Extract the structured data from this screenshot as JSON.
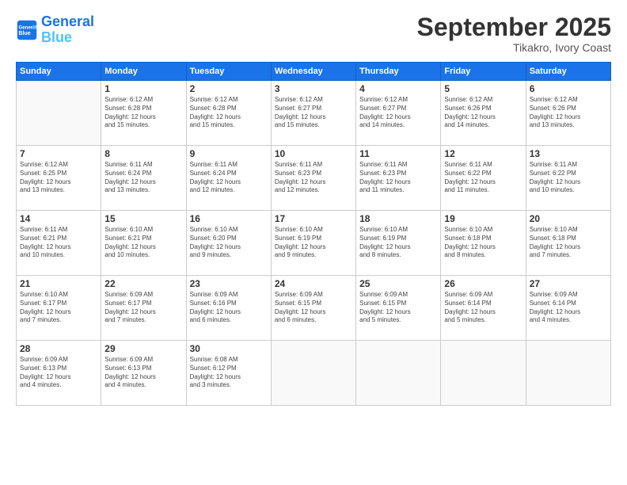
{
  "header": {
    "logo_line1": "General",
    "logo_line2": "Blue",
    "month": "September 2025",
    "location": "Tikakro, Ivory Coast"
  },
  "weekdays": [
    "Sunday",
    "Monday",
    "Tuesday",
    "Wednesday",
    "Thursday",
    "Friday",
    "Saturday"
  ],
  "weeks": [
    [
      {
        "day": "",
        "info": ""
      },
      {
        "day": "1",
        "info": "Sunrise: 6:12 AM\nSunset: 6:28 PM\nDaylight: 12 hours\nand 15 minutes."
      },
      {
        "day": "2",
        "info": "Sunrise: 6:12 AM\nSunset: 6:28 PM\nDaylight: 12 hours\nand 15 minutes."
      },
      {
        "day": "3",
        "info": "Sunrise: 6:12 AM\nSunset: 6:27 PM\nDaylight: 12 hours\nand 15 minutes."
      },
      {
        "day": "4",
        "info": "Sunrise: 6:12 AM\nSunset: 6:27 PM\nDaylight: 12 hours\nand 14 minutes."
      },
      {
        "day": "5",
        "info": "Sunrise: 6:12 AM\nSunset: 6:26 PM\nDaylight: 12 hours\nand 14 minutes."
      },
      {
        "day": "6",
        "info": "Sunrise: 6:12 AM\nSunset: 6:26 PM\nDaylight: 12 hours\nand 13 minutes."
      }
    ],
    [
      {
        "day": "7",
        "info": "Sunrise: 6:12 AM\nSunset: 6:25 PM\nDaylight: 12 hours\nand 13 minutes."
      },
      {
        "day": "8",
        "info": "Sunrise: 6:11 AM\nSunset: 6:24 PM\nDaylight: 12 hours\nand 13 minutes."
      },
      {
        "day": "9",
        "info": "Sunrise: 6:11 AM\nSunset: 6:24 PM\nDaylight: 12 hours\nand 12 minutes."
      },
      {
        "day": "10",
        "info": "Sunrise: 6:11 AM\nSunset: 6:23 PM\nDaylight: 12 hours\nand 12 minutes."
      },
      {
        "day": "11",
        "info": "Sunrise: 6:11 AM\nSunset: 6:23 PM\nDaylight: 12 hours\nand 11 minutes."
      },
      {
        "day": "12",
        "info": "Sunrise: 6:11 AM\nSunset: 6:22 PM\nDaylight: 12 hours\nand 11 minutes."
      },
      {
        "day": "13",
        "info": "Sunrise: 6:11 AM\nSunset: 6:22 PM\nDaylight: 12 hours\nand 10 minutes."
      }
    ],
    [
      {
        "day": "14",
        "info": "Sunrise: 6:11 AM\nSunset: 6:21 PM\nDaylight: 12 hours\nand 10 minutes."
      },
      {
        "day": "15",
        "info": "Sunrise: 6:10 AM\nSunset: 6:21 PM\nDaylight: 12 hours\nand 10 minutes."
      },
      {
        "day": "16",
        "info": "Sunrise: 6:10 AM\nSunset: 6:20 PM\nDaylight: 12 hours\nand 9 minutes."
      },
      {
        "day": "17",
        "info": "Sunrise: 6:10 AM\nSunset: 6:19 PM\nDaylight: 12 hours\nand 9 minutes."
      },
      {
        "day": "18",
        "info": "Sunrise: 6:10 AM\nSunset: 6:19 PM\nDaylight: 12 hours\nand 8 minutes."
      },
      {
        "day": "19",
        "info": "Sunrise: 6:10 AM\nSunset: 6:18 PM\nDaylight: 12 hours\nand 8 minutes."
      },
      {
        "day": "20",
        "info": "Sunrise: 6:10 AM\nSunset: 6:18 PM\nDaylight: 12 hours\nand 7 minutes."
      }
    ],
    [
      {
        "day": "21",
        "info": "Sunrise: 6:10 AM\nSunset: 6:17 PM\nDaylight: 12 hours\nand 7 minutes."
      },
      {
        "day": "22",
        "info": "Sunrise: 6:09 AM\nSunset: 6:17 PM\nDaylight: 12 hours\nand 7 minutes."
      },
      {
        "day": "23",
        "info": "Sunrise: 6:09 AM\nSunset: 6:16 PM\nDaylight: 12 hours\nand 6 minutes."
      },
      {
        "day": "24",
        "info": "Sunrise: 6:09 AM\nSunset: 6:15 PM\nDaylight: 12 hours\nand 6 minutes."
      },
      {
        "day": "25",
        "info": "Sunrise: 6:09 AM\nSunset: 6:15 PM\nDaylight: 12 hours\nand 5 minutes."
      },
      {
        "day": "26",
        "info": "Sunrise: 6:09 AM\nSunset: 6:14 PM\nDaylight: 12 hours\nand 5 minutes."
      },
      {
        "day": "27",
        "info": "Sunrise: 6:09 AM\nSunset: 6:14 PM\nDaylight: 12 hours\nand 4 minutes."
      }
    ],
    [
      {
        "day": "28",
        "info": "Sunrise: 6:09 AM\nSunset: 6:13 PM\nDaylight: 12 hours\nand 4 minutes."
      },
      {
        "day": "29",
        "info": "Sunrise: 6:09 AM\nSunset: 6:13 PM\nDaylight: 12 hours\nand 4 minutes."
      },
      {
        "day": "30",
        "info": "Sunrise: 6:08 AM\nSunset: 6:12 PM\nDaylight: 12 hours\nand 3 minutes."
      },
      {
        "day": "",
        "info": ""
      },
      {
        "day": "",
        "info": ""
      },
      {
        "day": "",
        "info": ""
      },
      {
        "day": "",
        "info": ""
      }
    ]
  ]
}
